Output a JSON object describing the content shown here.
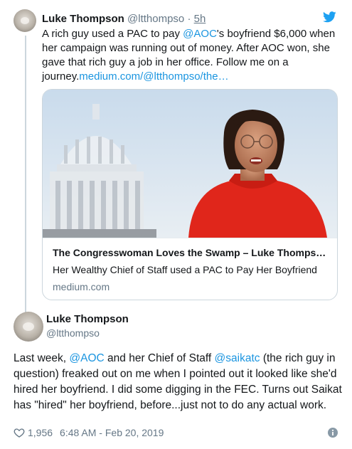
{
  "quoted_tweet": {
    "name": "Luke Thompson",
    "handle": "@ltthompso",
    "separator": " · ",
    "time": "5h",
    "text_1": "A rich guy used a PAC to pay ",
    "mention": "@AOC",
    "text_2": "'s boyfriend $6,000 when her campaign was running out of money. After AOC won, she gave that rich guy a job in her office. Follow me on a journey.",
    "url": "medium.com/@ltthompso/the…",
    "card": {
      "title": "The Congresswoman Loves the Swamp – Luke Thomps…",
      "description": "Her Wealthy Chief of Staff used a PAC to Pay Her Boyfriend",
      "domain": "medium.com"
    }
  },
  "main_tweet": {
    "name": "Luke Thompson",
    "handle": "@ltthompso",
    "text_1": "Last week, ",
    "mention_1": "@AOC",
    "text_2": " and her Chief of Staff ",
    "mention_2": "@saikatc",
    "text_3": " (the rich guy in question) freaked out on me when I pointed out it looked like she'd hired her boyfriend. I did some digging in the FEC. Turns out Saikat has \"hired\" her boyfriend, before...just not to do any actual work.",
    "likes": "1,956",
    "timestamp": "6:48 AM - Feb 20, 2019"
  },
  "colors": {
    "link": "#1b95e0",
    "muted": "#657786",
    "text": "#14171a",
    "border": "#ccd6dd"
  },
  "icons": [
    "twitter-bird-icon",
    "heart-icon",
    "info-icon"
  ]
}
